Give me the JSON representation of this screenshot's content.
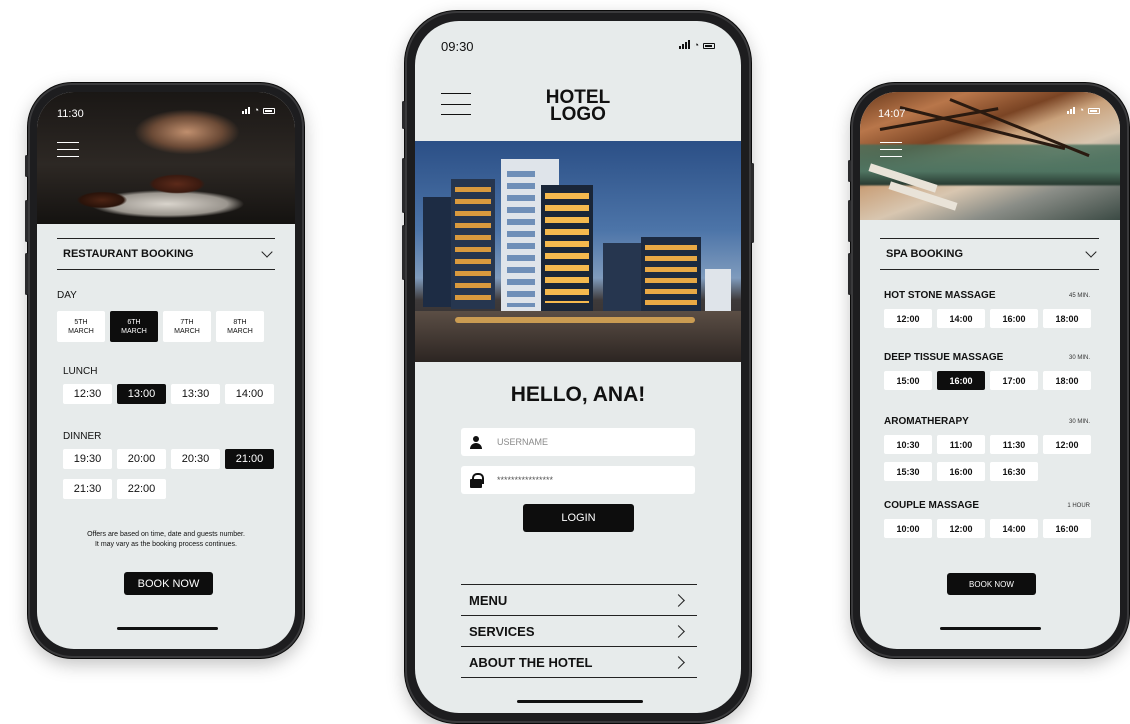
{
  "restaurant_screen": {
    "status_time": "11:30",
    "dropdown_label": "RESTAURANT BOOKING",
    "day_label": "DAY",
    "days": [
      {
        "line1": "5TH",
        "line2": "MARCH",
        "selected": false
      },
      {
        "line1": "6TH",
        "line2": "MARCH",
        "selected": true
      },
      {
        "line1": "7TH",
        "line2": "MARCH",
        "selected": false
      },
      {
        "line1": "8TH",
        "line2": "MARCH",
        "selected": false
      }
    ],
    "lunch_label": "LUNCH",
    "lunch_times": [
      {
        "time": "12:30",
        "selected": false
      },
      {
        "time": "13:00",
        "selected": true
      },
      {
        "time": "13:30",
        "selected": false
      },
      {
        "time": "14:00",
        "selected": false
      }
    ],
    "dinner_label": "DINNER",
    "dinner_times": [
      {
        "time": "19:30",
        "selected": false
      },
      {
        "time": "20:00",
        "selected": false
      },
      {
        "time": "20:30",
        "selected": false
      },
      {
        "time": "21:00",
        "selected": true
      },
      {
        "time": "21:30",
        "selected": false
      },
      {
        "time": "22:00",
        "selected": false
      }
    ],
    "note_line1": "Offers are based on time, date and guests number.",
    "note_line2": "It may vary as the booking process continues.",
    "book_button": "BOOK NOW"
  },
  "login_screen": {
    "status_time": "09:30",
    "logo_line1": "HOTEL",
    "logo_line2": "LOGO",
    "greeting": "HELLO, ANA!",
    "username_placeholder": "USERNAME",
    "password_value": "****************",
    "login_button": "LOGIN",
    "menu_items": [
      "MENU",
      "SERVICES",
      "ABOUT THE HOTEL"
    ]
  },
  "spa_screen": {
    "status_time": "14:07",
    "dropdown_label": "SPA BOOKING",
    "services": [
      {
        "name": "HOT STONE MASSAGE",
        "duration": "45 MIN.",
        "slots": [
          {
            "time": "12:00",
            "selected": false
          },
          {
            "time": "14:00",
            "selected": false
          },
          {
            "time": "16:00",
            "selected": false
          },
          {
            "time": "18:00",
            "selected": false
          }
        ]
      },
      {
        "name": "DEEP TISSUE MASSAGE",
        "duration": "30 MIN.",
        "slots": [
          {
            "time": "15:00",
            "selected": false
          },
          {
            "time": "16:00",
            "selected": true
          },
          {
            "time": "17:00",
            "selected": false
          },
          {
            "time": "18:00",
            "selected": false
          }
        ]
      },
      {
        "name": "AROMATHERAPY",
        "duration": "30 MIN.",
        "slots": [
          {
            "time": "10:30",
            "selected": false
          },
          {
            "time": "11:00",
            "selected": false
          },
          {
            "time": "11:30",
            "selected": false
          },
          {
            "time": "12:00",
            "selected": false
          },
          {
            "time": "15:30",
            "selected": false
          },
          {
            "time": "16:00",
            "selected": false
          },
          {
            "time": "16:30",
            "selected": false
          }
        ]
      },
      {
        "name": "COUPLE MASSAGE",
        "duration": "1 HOUR",
        "slots": [
          {
            "time": "10:00",
            "selected": false
          },
          {
            "time": "12:00",
            "selected": false
          },
          {
            "time": "14:00",
            "selected": false
          },
          {
            "time": "16:00",
            "selected": false
          }
        ]
      }
    ],
    "book_button": "BOOK NOW"
  }
}
